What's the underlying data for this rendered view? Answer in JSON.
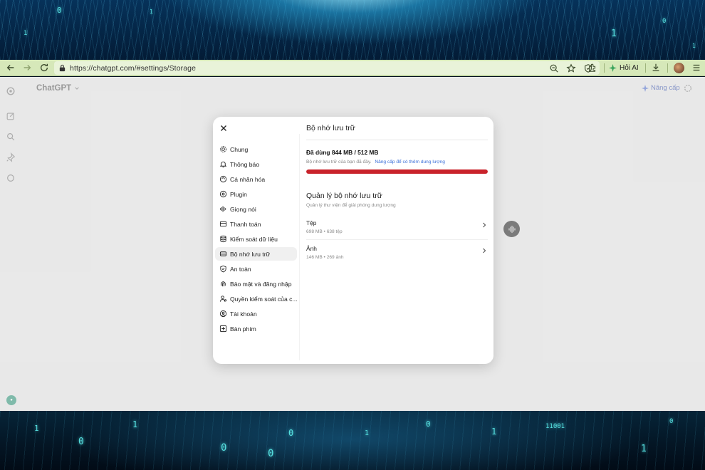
{
  "browser": {
    "url": "https://chatgpt.com/#settings/Storage",
    "ask_ai_label": "Hỏi AI"
  },
  "app": {
    "title": "ChatGPT",
    "upgrade_label": "Nâng cấp"
  },
  "settings": {
    "nav": [
      {
        "label": "Chung",
        "icon": "gear-icon"
      },
      {
        "label": "Thông báo",
        "icon": "bell-icon"
      },
      {
        "label": "Cá nhân hóa",
        "icon": "personalize-icon"
      },
      {
        "label": "Plugin",
        "icon": "plugin-icon"
      },
      {
        "label": "Giọng nói",
        "icon": "voice-icon"
      },
      {
        "label": "Thanh toán",
        "icon": "card-icon"
      },
      {
        "label": "Kiểm soát dữ liệu",
        "icon": "database-icon"
      },
      {
        "label": "Bộ nhớ lưu trữ",
        "icon": "storage-icon",
        "active": true
      },
      {
        "label": "An toàn",
        "icon": "shield-icon"
      },
      {
        "label": "Bảo mật và đăng nhập",
        "icon": "fingerprint-icon"
      },
      {
        "label": "Quyền kiểm soát của c...",
        "icon": "parental-icon"
      },
      {
        "label": "Tài khoản",
        "icon": "user-circle-icon"
      },
      {
        "label": "Bàn phím",
        "icon": "keyboard-icon"
      }
    ],
    "storage": {
      "title": "Bộ nhớ lưu trữ",
      "used_label": "Đã dùng 844 MB / 512 MB",
      "full_note": "Bộ nhớ lưu trữ của bạn đã đầy.",
      "upgrade_link": "Nâng cấp để có thêm dung lượng",
      "usage_fraction": 1.0,
      "bar_color": "#c9232b",
      "manage_title": "Quản lý bộ nhớ lưu trữ",
      "manage_subtitle": "Quản lý thư viện để giải phóng dung lượng",
      "items": [
        {
          "title": "Tệp",
          "subtitle": "698 MB • 638 tệp"
        },
        {
          "title": "Ảnh",
          "subtitle": "146 MB • 269 ảnh"
        }
      ]
    }
  }
}
